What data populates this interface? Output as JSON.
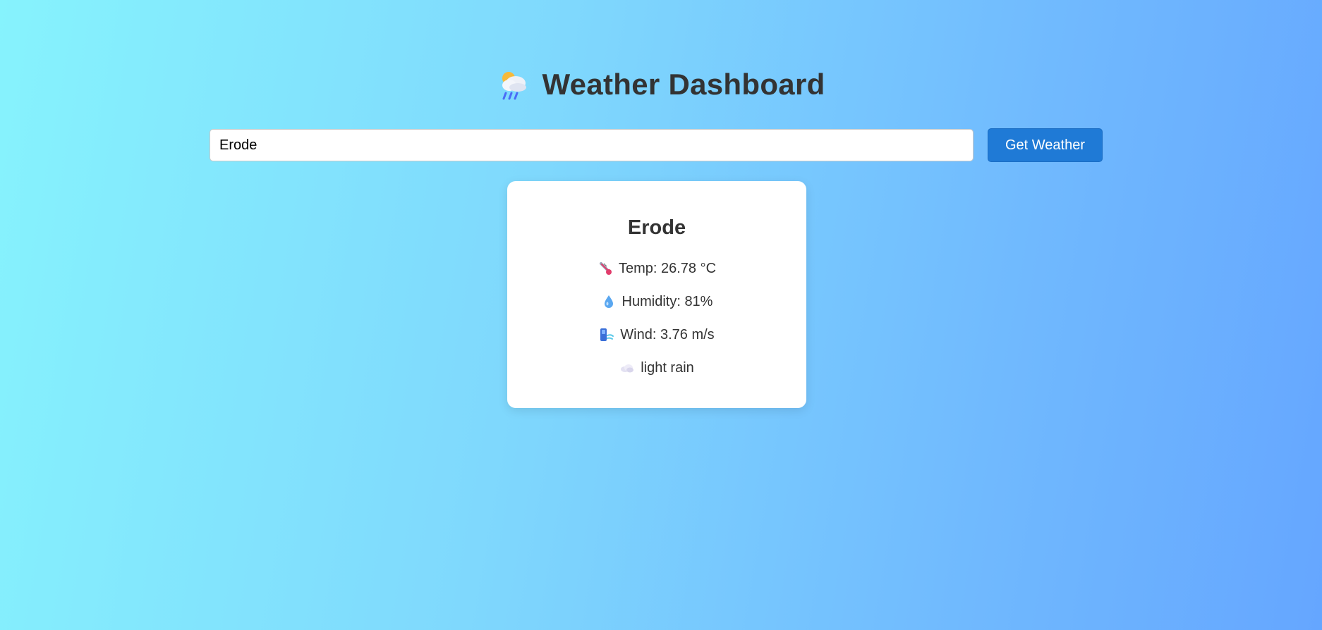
{
  "header": {
    "title": "Weather Dashboard",
    "icon": "sun-behind-rain-cloud-icon"
  },
  "search": {
    "value": "Erode",
    "button_label": "Get Weather"
  },
  "weather": {
    "city": "Erode",
    "temp": "Temp: 26.78 °C",
    "humidity": "Humidity: 81%",
    "wind": "Wind: 3.76 m/s",
    "description": "light rain"
  },
  "icons": {
    "temp": "thermometer-icon",
    "humidity": "droplet-icon",
    "wind": "wind-icon",
    "description": "cloud-icon"
  },
  "colors": {
    "background_start": "#86f3fd",
    "background_end": "#65a6ff",
    "button": "#1f7ad6",
    "text": "#333333",
    "card": "#ffffff"
  }
}
